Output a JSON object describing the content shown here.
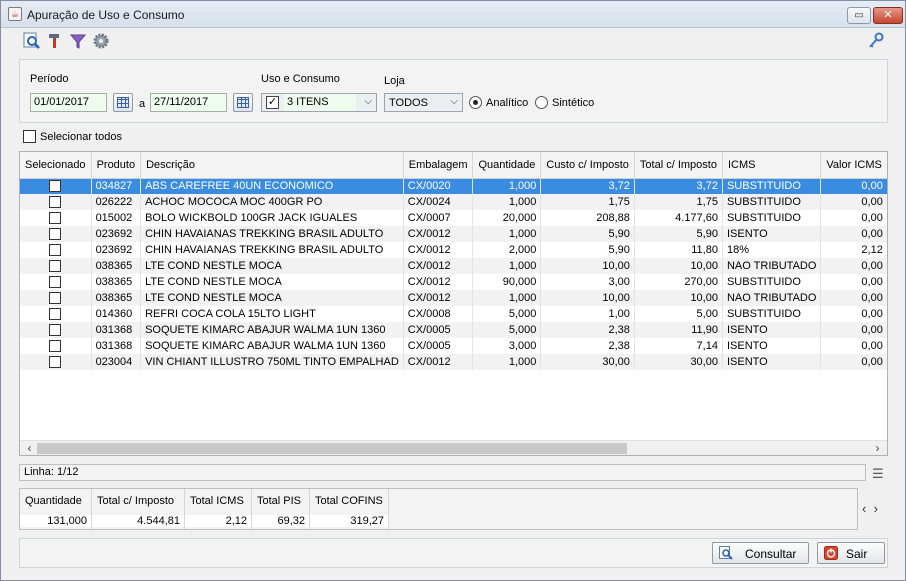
{
  "window": {
    "title": "Apuração de Uso e Consumo"
  },
  "toolbar": {
    "icons": [
      "search-report-icon",
      "tools-icon",
      "filter-icon",
      "settings-gear-icon",
      "key-icon"
    ]
  },
  "filters": {
    "periodo_label": "Período",
    "date_from": "01/01/2017",
    "a_label": "a",
    "date_to": "27/11/2017",
    "uso_label": "Uso e Consumo",
    "uso_value": "3 ITENS",
    "loja_label": "Loja",
    "loja_value": "TODOS",
    "analitico_label": "Analítico",
    "sintetico_label": "Sintético",
    "mode_selected": "Analítico"
  },
  "select_all_label": "Selecionar todos",
  "table": {
    "columns": [
      "Selecionado",
      "Produto",
      "Descrição",
      "Embalagem",
      "Quantidade",
      "Custo c/ Imposto",
      "Total c/ Imposto",
      "ICMS",
      "Valor ICMS"
    ],
    "rows": [
      {
        "produto": "034827",
        "descricao": "ABS CAREFREE 40UN ECONOMICO",
        "embalagem": "CX/0020",
        "quantidade": "1,000",
        "custo": "3,72",
        "total": "3,72",
        "icms": "SUBSTITUIDO",
        "valor_icms": "0,00"
      },
      {
        "produto": "026222",
        "descricao": "ACHOC MOCOCA MOC 400GR PO",
        "embalagem": "CX/0024",
        "quantidade": "1,000",
        "custo": "1,75",
        "total": "1,75",
        "icms": "SUBSTITUIDO",
        "valor_icms": "0,00"
      },
      {
        "produto": "015002",
        "descricao": "BOLO WICKBOLD 100GR JACK IGUALES",
        "embalagem": "CX/0007",
        "quantidade": "20,000",
        "custo": "208,88",
        "total": "4.177,60",
        "icms": "SUBSTITUIDO",
        "valor_icms": "0,00"
      },
      {
        "produto": "023692",
        "descricao": "CHIN HAVAIANAS TREKKING BRASIL ADULTO",
        "embalagem": "CX/0012",
        "quantidade": "1,000",
        "custo": "5,90",
        "total": "5,90",
        "icms": "ISENTO",
        "valor_icms": "0,00"
      },
      {
        "produto": "023692",
        "descricao": "CHIN HAVAIANAS TREKKING BRASIL ADULTO",
        "embalagem": "CX/0012",
        "quantidade": "2,000",
        "custo": "5,90",
        "total": "11,80",
        "icms": "18%",
        "valor_icms": "2,12"
      },
      {
        "produto": "038365",
        "descricao": "LTE COND NESTLE MOCA",
        "embalagem": "CX/0012",
        "quantidade": "1,000",
        "custo": "10,00",
        "total": "10,00",
        "icms": "NAO TRIBUTADO",
        "valor_icms": "0,00"
      },
      {
        "produto": "038365",
        "descricao": "LTE COND NESTLE MOCA",
        "embalagem": "CX/0012",
        "quantidade": "90,000",
        "custo": "3,00",
        "total": "270,00",
        "icms": "SUBSTITUIDO",
        "valor_icms": "0,00"
      },
      {
        "produto": "038365",
        "descricao": "LTE COND NESTLE MOCA",
        "embalagem": "CX/0012",
        "quantidade": "1,000",
        "custo": "10,00",
        "total": "10,00",
        "icms": "NAO TRIBUTADO",
        "valor_icms": "0,00"
      },
      {
        "produto": "014360",
        "descricao": "REFRI COCA COLA 15LTO LIGHT",
        "embalagem": "CX/0008",
        "quantidade": "5,000",
        "custo": "1,00",
        "total": "5,00",
        "icms": "SUBSTITUIDO",
        "valor_icms": "0,00"
      },
      {
        "produto": "031368",
        "descricao": "SOQUETE KIMARC ABAJUR WALMA 1UN 1360",
        "embalagem": "CX/0005",
        "quantidade": "5,000",
        "custo": "2,38",
        "total": "11,90",
        "icms": "ISENTO",
        "valor_icms": "0,00"
      },
      {
        "produto": "031368",
        "descricao": "SOQUETE KIMARC ABAJUR WALMA 1UN 1360",
        "embalagem": "CX/0005",
        "quantidade": "3,000",
        "custo": "2,38",
        "total": "7,14",
        "icms": "ISENTO",
        "valor_icms": "0,00"
      },
      {
        "produto": "023004",
        "descricao": "VIN CHIANT ILLUSTRO 750ML TINTO EMPALHAD",
        "embalagem": "CX/0012",
        "quantidade": "1,000",
        "custo": "30,00",
        "total": "30,00",
        "icms": "ISENTO",
        "valor_icms": "0,00"
      }
    ],
    "selected_row": 0
  },
  "status": {
    "linha": "Linha: 1/12"
  },
  "totals": {
    "quantidade_label": "Quantidade",
    "quantidade": "131,000",
    "total_label": "Total c/ Imposto",
    "total": "4.544,81",
    "icms_label": "Total ICMS",
    "icms": "2,12",
    "pis_label": "Total PIS",
    "pis": "69,32",
    "cofins_label": "Total COFINS",
    "cofins": "319,27"
  },
  "buttons": {
    "consultar": "Consultar",
    "sair": "Sair"
  },
  "colors": {
    "selection": "#3a8ce0",
    "field_bg": "#eefbee",
    "close_red": "#c4452d"
  }
}
